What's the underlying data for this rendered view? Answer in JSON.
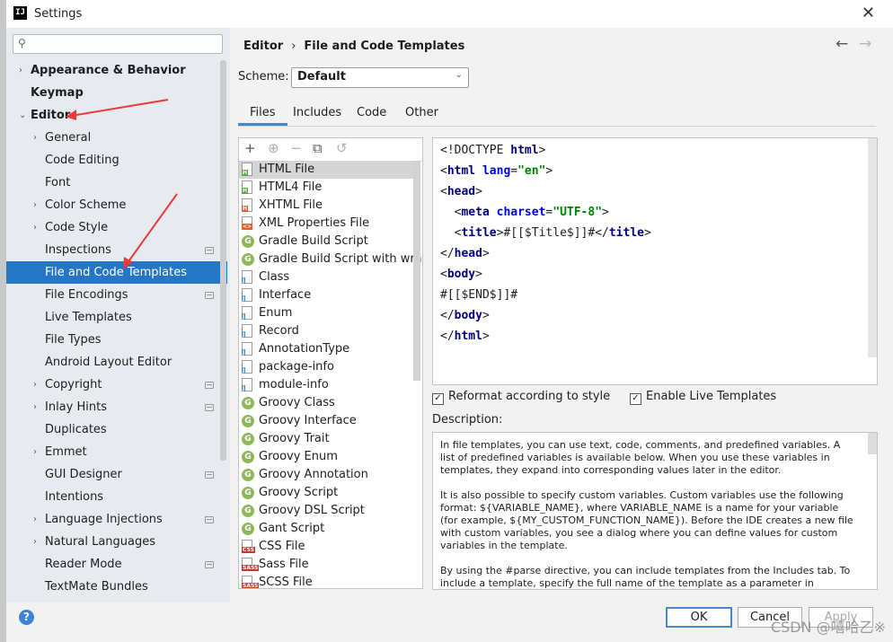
{
  "window": {
    "title": "Settings",
    "app_icon_text": "IJ",
    "close_glyph": "✕"
  },
  "sidebar": {
    "search_placeholder": "",
    "items": [
      {
        "label": "Appearance & Behavior",
        "arrow": "›",
        "bold": true
      },
      {
        "label": "Keymap",
        "bold": true
      },
      {
        "label": "Editor",
        "arrow": "⌄",
        "bold": true
      },
      {
        "label": "General",
        "arrow": "›"
      },
      {
        "label": "Code Editing"
      },
      {
        "label": "Font"
      },
      {
        "label": "Color Scheme",
        "arrow": "›"
      },
      {
        "label": "Code Style",
        "arrow": "›"
      },
      {
        "label": "Inspections",
        "badge": true
      },
      {
        "label": "File and Code Templates",
        "selected": true
      },
      {
        "label": "File Encodings",
        "badge": true
      },
      {
        "label": "Live Templates"
      },
      {
        "label": "File Types"
      },
      {
        "label": "Android Layout Editor"
      },
      {
        "label": "Copyright",
        "arrow": "›",
        "badge": true
      },
      {
        "label": "Inlay Hints",
        "arrow": "›",
        "badge": true
      },
      {
        "label": "Duplicates"
      },
      {
        "label": "Emmet",
        "arrow": "›"
      },
      {
        "label": "GUI Designer",
        "badge": true
      },
      {
        "label": "Intentions"
      },
      {
        "label": "Language Injections",
        "arrow": "›",
        "badge": true
      },
      {
        "label": "Natural Languages",
        "arrow": "›"
      },
      {
        "label": "Reader Mode",
        "badge": true
      },
      {
        "label": "TextMate Bundles"
      }
    ]
  },
  "header": {
    "breadcrumb_parent": "Editor",
    "breadcrumb_sep": "›",
    "breadcrumb_current": "File and Code Templates",
    "back_glyph": "←",
    "forward_glyph": "→"
  },
  "scheme": {
    "label": "Scheme:",
    "value": "Default"
  },
  "tabs": [
    "Files",
    "Includes",
    "Code",
    "Other"
  ],
  "templates": [
    {
      "name": "HTML File",
      "icon": "html",
      "selected": true
    },
    {
      "name": "HTML4 File",
      "icon": "html"
    },
    {
      "name": "XHTML File",
      "icon": "html-orange"
    },
    {
      "name": "XML Properties File",
      "icon": "xml"
    },
    {
      "name": "Gradle Build Script",
      "icon": "groovy"
    },
    {
      "name": "Gradle Build Script with wrapper",
      "icon": "groovy"
    },
    {
      "name": "Class",
      "icon": "java"
    },
    {
      "name": "Interface",
      "icon": "java"
    },
    {
      "name": "Enum",
      "icon": "java"
    },
    {
      "name": "Record",
      "icon": "java"
    },
    {
      "name": "AnnotationType",
      "icon": "java"
    },
    {
      "name": "package-info",
      "icon": "java"
    },
    {
      "name": "module-info",
      "icon": "java"
    },
    {
      "name": "Groovy Class",
      "icon": "groovy"
    },
    {
      "name": "Groovy Interface",
      "icon": "groovy"
    },
    {
      "name": "Groovy Trait",
      "icon": "groovy"
    },
    {
      "name": "Groovy Enum",
      "icon": "groovy"
    },
    {
      "name": "Groovy Annotation",
      "icon": "groovy"
    },
    {
      "name": "Groovy Script",
      "icon": "groovy"
    },
    {
      "name": "Groovy DSL Script",
      "icon": "groovy"
    },
    {
      "name": "Gant Script",
      "icon": "groovy"
    },
    {
      "name": "CSS File",
      "icon": "css"
    },
    {
      "name": "Sass File",
      "icon": "sass"
    },
    {
      "name": "SCSS File",
      "icon": "sass"
    }
  ],
  "editor": {
    "lines": [
      [
        {
          "t": "<!DOCTYPE ",
          "c": ""
        },
        {
          "t": "html",
          "c": "kw"
        },
        {
          "t": ">",
          "c": ""
        }
      ],
      [
        {
          "t": "<",
          "c": ""
        },
        {
          "t": "html ",
          "c": "kw"
        },
        {
          "t": "lang",
          "c": "attr"
        },
        {
          "t": "=",
          "c": ""
        },
        {
          "t": "\"en\"",
          "c": "str"
        },
        {
          "t": ">",
          "c": ""
        }
      ],
      [
        {
          "t": "<",
          "c": ""
        },
        {
          "t": "head",
          "c": "kw"
        },
        {
          "t": ">",
          "c": ""
        }
      ],
      [
        {
          "t": "  <",
          "c": ""
        },
        {
          "t": "meta ",
          "c": "kw"
        },
        {
          "t": "charset",
          "c": "attr"
        },
        {
          "t": "=",
          "c": ""
        },
        {
          "t": "\"UTF-8\"",
          "c": "str"
        },
        {
          "t": ">",
          "c": ""
        }
      ],
      [
        {
          "t": "  <",
          "c": ""
        },
        {
          "t": "title",
          "c": "kw"
        },
        {
          "t": ">#[[$Title$]]#</",
          "c": ""
        },
        {
          "t": "title",
          "c": "kw"
        },
        {
          "t": ">",
          "c": ""
        }
      ],
      [
        {
          "t": "</",
          "c": ""
        },
        {
          "t": "head",
          "c": "kw"
        },
        {
          "t": ">",
          "c": ""
        }
      ],
      [
        {
          "t": "<",
          "c": ""
        },
        {
          "t": "body",
          "c": "kw"
        },
        {
          "t": ">",
          "c": ""
        }
      ],
      [
        {
          "t": "#[[$END$]]#",
          "c": ""
        }
      ],
      [
        {
          "t": "</",
          "c": ""
        },
        {
          "t": "body",
          "c": "kw"
        },
        {
          "t": ">",
          "c": ""
        }
      ],
      [
        {
          "t": "</",
          "c": ""
        },
        {
          "t": "html",
          "c": "kw"
        },
        {
          "t": ">",
          "c": ""
        }
      ]
    ]
  },
  "options": {
    "reformat": {
      "label": "Reformat according to style",
      "checked": true
    },
    "live_templates": {
      "label": "Enable Live Templates",
      "checked": true
    }
  },
  "description": {
    "label": "Description:",
    "paragraphs": [
      "In file templates, you can use text, code, comments, and predefined variables. A list of predefined variables is available below. When you use these variables in templates, they expand into corresponding values later in the editor.",
      "It is also possible to specify custom variables. Custom variables use the following format: ${VARIABLE_NAME}, where VARIABLE_NAME is a name for your variable (for example, ${MY_CUSTOM_FUNCTION_NAME}). Before the IDE creates a new file with custom variables, you see a dialog where you can define values for custom variables in the template.",
      "By using the #parse directive, you can include templates from the Includes tab. To include a template, specify the full name of the template as a parameter in"
    ]
  },
  "footer": {
    "help": "?",
    "ok": "OK",
    "cancel": "Cancel",
    "apply": "Apply"
  },
  "watermark": "CSDN @嘻哈乙※",
  "colors": {
    "selection": "#2676c8",
    "annotation_arrow": "#e83a3a"
  }
}
